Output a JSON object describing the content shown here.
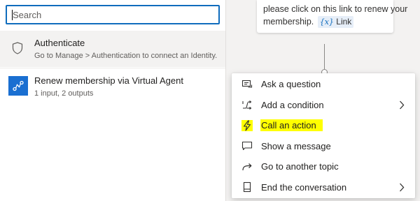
{
  "search": {
    "placeholder": "Search"
  },
  "picker": {
    "items": [
      {
        "title": "Authenticate",
        "subtitle": "Go to Manage > Authentication to connect an Identity...",
        "icon": "shield-icon"
      },
      {
        "title": "Renew membership via Virtual Agent",
        "subtitle": "1 input, 2 outputs",
        "icon": "flow-icon"
      }
    ]
  },
  "message_node": {
    "line1": "please click on this link to renew your",
    "line2": "membership.",
    "variable_symbol": "{x}",
    "variable_name": "Link"
  },
  "node_menu": {
    "items": [
      {
        "label": "Ask a question",
        "icon": "question-node-icon"
      },
      {
        "label": "Add a condition",
        "icon": "condition-branch-icon",
        "has_submenu": true
      },
      {
        "label": "Call an action",
        "icon": "lightning-icon",
        "highlighted": true
      },
      {
        "label": "Show a message",
        "icon": "message-icon"
      },
      {
        "label": "Go to another topic",
        "icon": "redirect-arrow-icon"
      },
      {
        "label": "End the conversation",
        "icon": "end-conversation-icon",
        "has_submenu": true
      }
    ]
  },
  "colors": {
    "accent": "#0f6cbd",
    "flow_icon_bg": "#1a6fd1",
    "highlight": "#ffff00",
    "canvas_bg": "#f3f2f1"
  }
}
